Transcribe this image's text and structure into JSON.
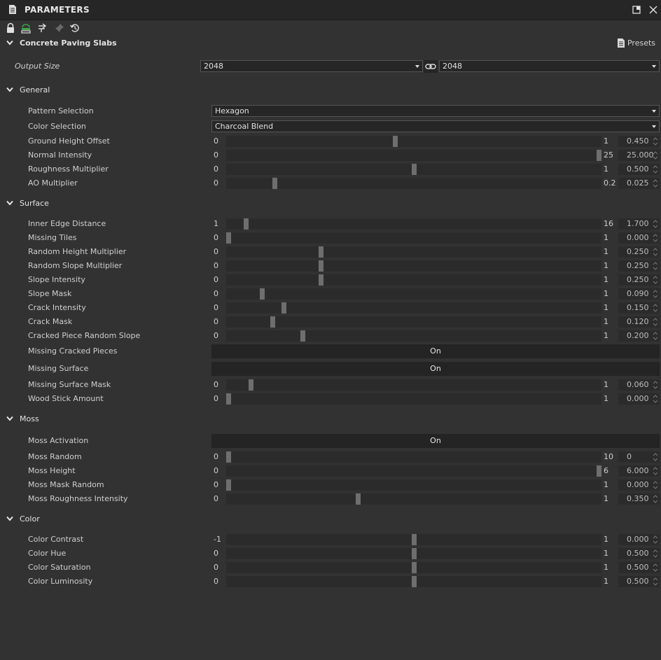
{
  "panel": {
    "title": "PARAMETERS",
    "graph_name": "Concrete Paving Slabs",
    "presets_label": "Presets"
  },
  "output_size": {
    "label": "Output Size",
    "width": "2048",
    "height": "2048"
  },
  "sections": {
    "general": "General",
    "surface": "Surface",
    "moss": "Moss",
    "color": "Color"
  },
  "general": {
    "pattern": {
      "label": "Pattern Selection",
      "value": "Hexagon"
    },
    "color_sel": {
      "label": "Color Selection",
      "value": "Charcoal Blend"
    }
  },
  "sliders": [
    {
      "label": "Ground Height Offset",
      "min": "0",
      "max": "1",
      "value": "0.450",
      "fraction": 0.45
    },
    {
      "label": "Normal Intensity",
      "min": "0",
      "max": "25",
      "value": "25.000",
      "fraction": 1.0
    },
    {
      "label": "Roughness Multiplier",
      "min": "0",
      "max": "1",
      "value": "0.500",
      "fraction": 0.5
    },
    {
      "label": "AO Multiplier",
      "min": "0",
      "max": "0.2",
      "value": "0.025",
      "fraction": 0.125
    },
    {
      "label": "Inner Edge Distance",
      "min": "1",
      "max": "16",
      "value": "1.700",
      "fraction": 0.047
    },
    {
      "label": "Missing Tiles",
      "min": "0",
      "max": "1",
      "value": "0.000",
      "fraction": 0.0
    },
    {
      "label": "Random Height Multiplier",
      "min": "0",
      "max": "1",
      "value": "0.250",
      "fraction": 0.25
    },
    {
      "label": "Random Slope Multiplier",
      "min": "0",
      "max": "1",
      "value": "0.250",
      "fraction": 0.25
    },
    {
      "label": "Slope Intensity",
      "min": "0",
      "max": "1",
      "value": "0.250",
      "fraction": 0.25
    },
    {
      "label": "Slope Mask",
      "min": "0",
      "max": "1",
      "value": "0.090",
      "fraction": 0.09
    },
    {
      "label": "Crack Intensity",
      "min": "0",
      "max": "1",
      "value": "0.150",
      "fraction": 0.15
    },
    {
      "label": "Crack Mask",
      "min": "0",
      "max": "1",
      "value": "0.120",
      "fraction": 0.12
    },
    {
      "label": "Cracked Piece Random Slope",
      "min": "0",
      "max": "1",
      "value": "0.200",
      "fraction": 0.2
    },
    {
      "label": "Missing Surface Mask",
      "min": "0",
      "max": "1",
      "value": "0.060",
      "fraction": 0.06
    },
    {
      "label": "Wood Stick Amount",
      "min": "0",
      "max": "1",
      "value": "0.000",
      "fraction": 0.0
    },
    {
      "label": "Moss Random",
      "min": "0",
      "max": "10",
      "value": "0",
      "fraction": 0.0
    },
    {
      "label": "Moss Height",
      "min": "0",
      "max": "6",
      "value": "6.000",
      "fraction": 1.0
    },
    {
      "label": "Moss Mask Random",
      "min": "0",
      "max": "1",
      "value": "0.000",
      "fraction": 0.0
    },
    {
      "label": "Moss Roughness Intensity",
      "min": "0",
      "max": "1",
      "value": "0.350",
      "fraction": 0.35
    },
    {
      "label": "Color Contrast",
      "min": "-1",
      "max": "1",
      "value": "0.000",
      "fraction": 0.5
    },
    {
      "label": "Color Hue",
      "min": "0",
      "max": "1",
      "value": "0.500",
      "fraction": 0.5
    },
    {
      "label": "Color Saturation",
      "min": "0",
      "max": "1",
      "value": "0.500",
      "fraction": 0.5
    },
    {
      "label": "Color Luminosity",
      "min": "0",
      "max": "1",
      "value": "0.500",
      "fraction": 0.5
    }
  ],
  "toggles": [
    {
      "label": "Missing Cracked Pieces",
      "value": "On"
    },
    {
      "label": "Missing Surface",
      "value": "On"
    },
    {
      "label": "Moss Activation",
      "value": "On"
    }
  ],
  "colors": {
    "background": "#323232",
    "knob": "#6e6e6e",
    "lock_icon": "#e0e0e0",
    "share_icon": "#3fa34d"
  }
}
